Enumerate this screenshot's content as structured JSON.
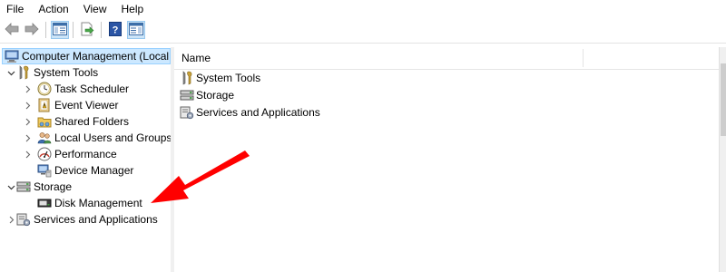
{
  "menu": {
    "file": "File",
    "action": "Action",
    "view": "View",
    "help": "Help"
  },
  "tree": {
    "root": "Computer Management (Local",
    "system_tools": "System Tools",
    "task_scheduler": "Task Scheduler",
    "event_viewer": "Event Viewer",
    "shared_folders": "Shared Folders",
    "local_users": "Local Users and Groups",
    "performance": "Performance",
    "device_manager": "Device Manager",
    "storage": "Storage",
    "disk_management": "Disk Management",
    "services_apps": "Services and Applications"
  },
  "list": {
    "column_name": "Name",
    "items": [
      "System Tools",
      "Storage",
      "Services and Applications"
    ]
  },
  "colors": {
    "selection": "#cce8ff",
    "annotation_arrow": "#ff0000"
  },
  "icons": {
    "toolbar": [
      "back-arrow-icon",
      "forward-arrow-icon",
      "show-hide-console-tree-icon",
      "export-list-icon",
      "help-icon",
      "show-hide-action-pane-icon"
    ]
  }
}
